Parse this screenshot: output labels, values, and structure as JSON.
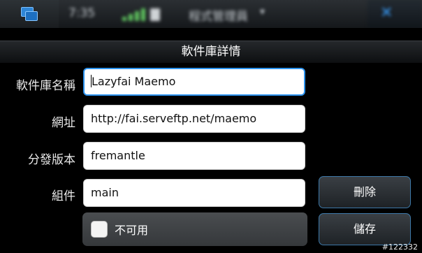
{
  "statusbar": {
    "time": "7:35",
    "app_title": "程式管理員",
    "menu_arrow": "▾",
    "close_glyph": "✕"
  },
  "dialog": {
    "title": "軟件庫詳情"
  },
  "form": {
    "name_label": "軟件庫名稱",
    "name_value": "Lazyfai Maemo",
    "url_label": "網址",
    "url_value": "http://fai.serveftp.net/maemo",
    "dist_label": "分發版本",
    "dist_value": "fremantle",
    "component_label": "組件",
    "component_value": "main",
    "disabled_label": "不可用",
    "disabled_checked": false
  },
  "buttons": {
    "delete_label": "刪除",
    "save_label": "儲存"
  },
  "watermark": "#122332",
  "colors": {
    "accent": "#2d93ee",
    "button_border": "#3d78a8",
    "background": "#000000"
  }
}
